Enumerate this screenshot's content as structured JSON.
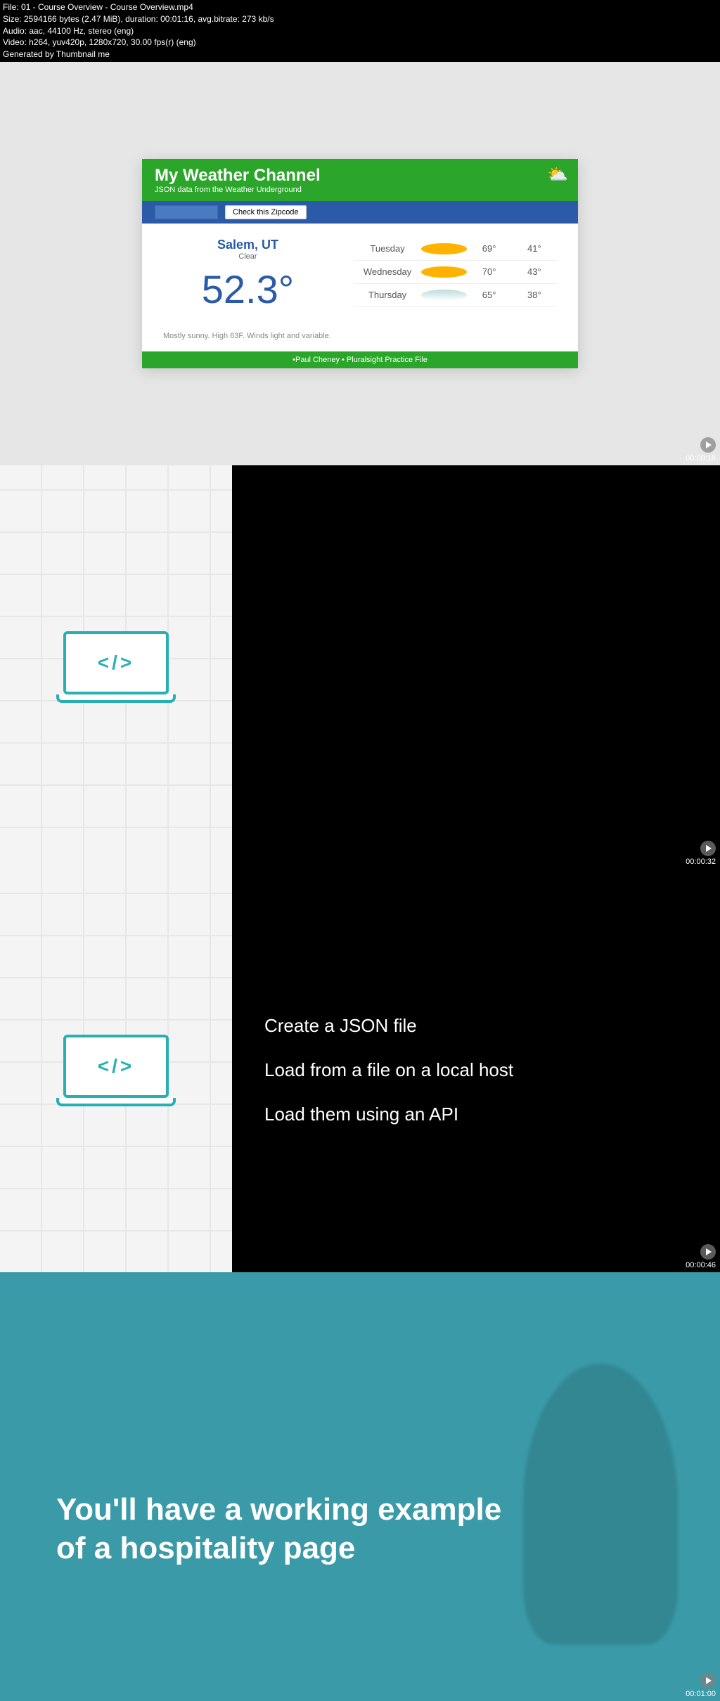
{
  "metadata": {
    "filename": "File: 01 - Course Overview - Course Overview.mp4",
    "size": "Size: 2594166 bytes (2.47 MiB), duration: 00:01:16, avg.bitrate: 273 kb/s",
    "audio": "Audio: aac, 44100 Hz, stereo (eng)",
    "video": "Video: h264, yuv420p, 1280x720, 30.00 fps(r) (eng)",
    "generated": "Generated by Thumbnail me"
  },
  "frame1": {
    "timestamp": "00:00:18",
    "weather": {
      "title": "My Weather Channel",
      "subtitle": "JSON data from the Weather Underground",
      "button": "Check this Zipcode",
      "city": "Salem, UT",
      "condition": "Clear",
      "temp": "52.3°",
      "forecast": [
        {
          "day": "Tuesday",
          "icon": "sunny",
          "hi": "69°",
          "lo": "41°"
        },
        {
          "day": "Wednesday",
          "icon": "sunny",
          "hi": "70°",
          "lo": "43°"
        },
        {
          "day": "Thursday",
          "icon": "cloudy",
          "hi": "65°",
          "lo": "38°"
        }
      ],
      "summary": "Mostly sunny. High 63F. Winds light and variable.",
      "footer": "•Paul Cheney • Pluralsight Practice File"
    }
  },
  "frame2": {
    "timestamp": "00:00:32"
  },
  "frame3": {
    "timestamp": "00:00:46",
    "lines": {
      "l1": "Create a JSON file",
      "l2": "Load from a file on a local host",
      "l3": "Load them using an API"
    }
  },
  "frame4": {
    "timestamp": "00:01:00",
    "text_l1": "You'll have a working example",
    "text_l2": "of a hospitality page"
  }
}
